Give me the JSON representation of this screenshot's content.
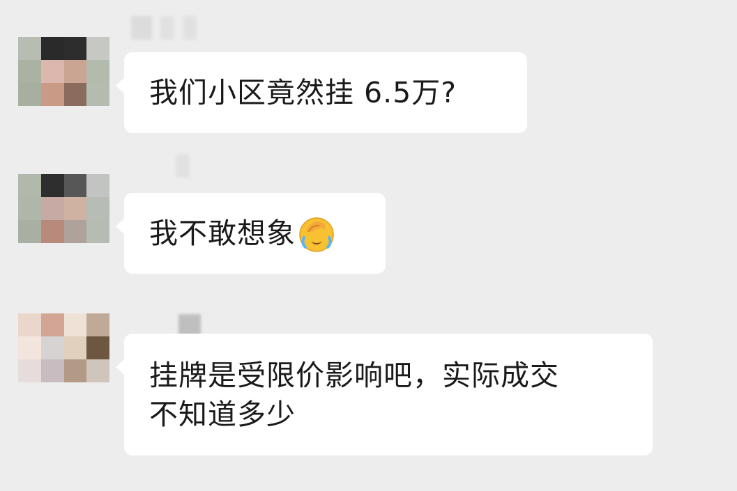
{
  "messages": [
    {
      "text_lines": [
        "我们小区竟然挂 6.5万?"
      ],
      "avatar_colors": [
        "#b7bdb2",
        "#2a2a2a",
        "#2d2d2d",
        "#c6c8c4",
        "#aab3a2",
        "#dcb7ad",
        "#c9a592",
        "#b3bbad",
        "#a7b0a0",
        "#c99a86",
        "#8a6c5e",
        "#b4bcb0"
      ]
    },
    {
      "text_lines": [
        "我不敢想象"
      ],
      "emoji": "face-palm-crying-emoji",
      "avatar_colors": [
        "#b1b9ad",
        "#2e2e2e",
        "#575757",
        "#c2c4c2",
        "#aeb7aa",
        "#c7aaa3",
        "#cfb2a2",
        "#b7bdb5",
        "#a9b0a3",
        "#b78a7c",
        "#aea29a",
        "#b5bcb2"
      ]
    },
    {
      "text_lines": [
        "挂牌是受限价影响吧，实际成交",
        "不知道多少"
      ],
      "avatar_colors": [
        "#ead7cb",
        "#d3a595",
        "#eee1d5",
        "#c1a997",
        "#f3e4dd",
        "#d6d4d2",
        "#e1d0bd",
        "#6d5740",
        "#e6dcdb",
        "#c8bcc1",
        "#b39a86",
        "#cfc5bb"
      ]
    }
  ],
  "colors": {
    "background": "#ededed",
    "bubble": "#ffffff",
    "text": "#1a1a1a"
  }
}
